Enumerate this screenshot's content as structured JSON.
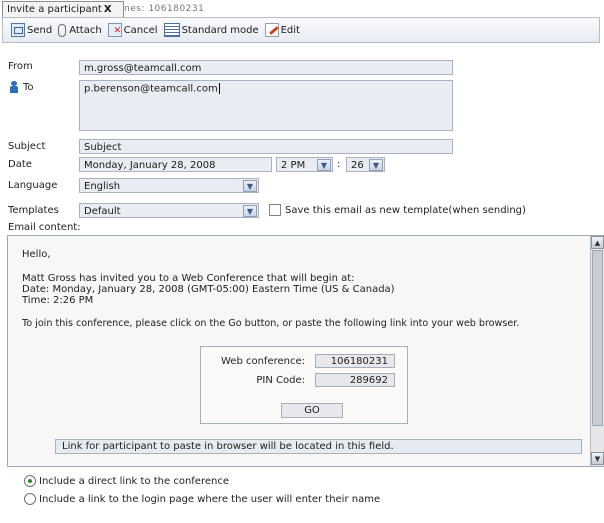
{
  "tab": {
    "title": "Invite a participant",
    "close": "X",
    "overflow_text": "nes: 106180231"
  },
  "toolbar": {
    "send": "Send",
    "attach": "Attach",
    "cancel": "Cancel",
    "standard_mode": "Standard mode",
    "edit": "Edit"
  },
  "form": {
    "from_label": "From",
    "from_value": "m.gross@teamcall.com",
    "to_label": "To",
    "to_value": "p.berenson@teamcall.com",
    "subject_label": "Subject",
    "subject_value": "Subject",
    "date_label": "Date",
    "date_value": "Monday, January 28, 2008",
    "hour_value": "2 PM",
    "time_sep": ":",
    "minute_value": "26",
    "language_label": "Language",
    "language_value": "English",
    "templates_label": "Templates",
    "template_value": "Default",
    "save_template_label": "Save this email as new template(when sending)",
    "email_content_label": "Email content:"
  },
  "email": {
    "greeting": "Hello,",
    "line1": "Matt Gross has invited you to a Web Conference that will begin at:",
    "line2": "Date: Monday, January 28, 2008 (GMT-05:00) Eastern Time (US & Canada)",
    "line3": "Time: 2:26 PM",
    "line4": "To join this conference, please click on the Go button, or paste the following link into your web browser.",
    "web_conference_label": "Web conference:",
    "web_conference_value": "106180231",
    "pin_label": "PIN Code:",
    "pin_value": "289692",
    "go_label": "GO",
    "link_placeholder": "Link for participant to paste in browser will be located in this field."
  },
  "options": {
    "direct_link": "Include a direct link to the conference",
    "login_link": "Include a link to the login page where the user will enter their name",
    "selected": "direct_link"
  },
  "colors": {
    "field_bg": "#e9edf3",
    "border": "#a9b2be",
    "accent": "#2a6fc2"
  }
}
